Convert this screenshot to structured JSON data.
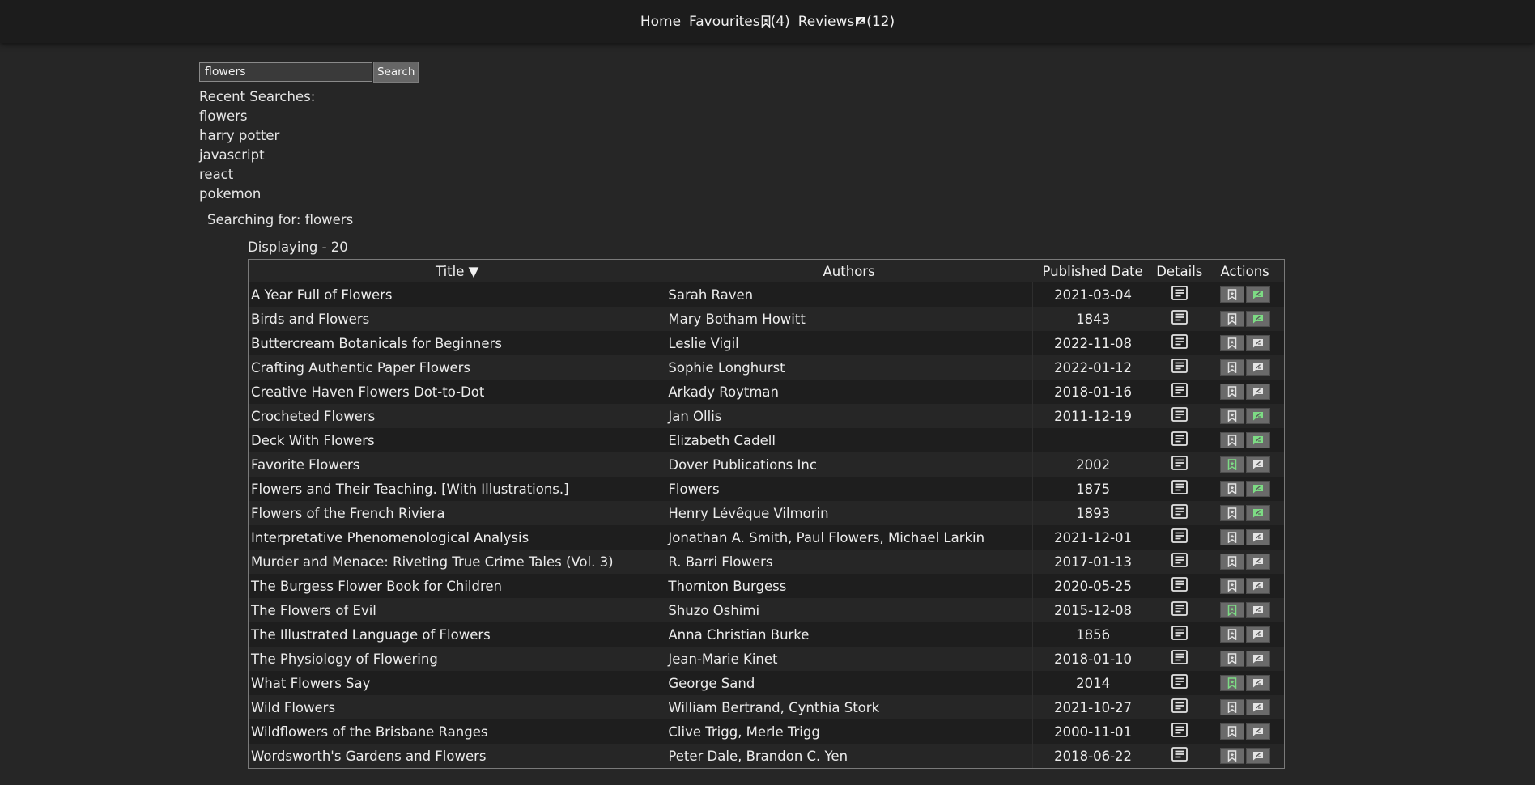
{
  "nav": {
    "home_label": "Home",
    "favourites_label": "Favourites",
    "favourites_count": "(4)",
    "reviews_label": "Reviews",
    "reviews_count": "(12)"
  },
  "search": {
    "value": "flowers",
    "button_label": "Search"
  },
  "recent": {
    "heading": "Recent Searches:",
    "items": [
      "flowers",
      "harry potter",
      "javascript",
      "react",
      "pokemon"
    ]
  },
  "status": {
    "searching_for": "Searching for: flowers",
    "displaying": "Displaying - 20"
  },
  "table": {
    "headers": {
      "title": "Title ▼",
      "authors": "Authors",
      "published": "Published Date",
      "details": "Details",
      "actions": "Actions"
    },
    "rows": [
      {
        "title": "A Year Full of Flowers",
        "authors": "Sarah Raven",
        "date": "2021-03-04",
        "favourite": false,
        "reviewed": true
      },
      {
        "title": "Birds and Flowers",
        "authors": "Mary Botham Howitt",
        "date": "1843",
        "favourite": false,
        "reviewed": true
      },
      {
        "title": "Buttercream Botanicals for Beginners",
        "authors": "Leslie Vigil",
        "date": "2022-11-08",
        "favourite": false,
        "reviewed": false
      },
      {
        "title": "Crafting Authentic Paper Flowers",
        "authors": "Sophie Longhurst",
        "date": "2022-01-12",
        "favourite": false,
        "reviewed": false
      },
      {
        "title": "Creative Haven Flowers Dot-to-Dot",
        "authors": "Arkady Roytman",
        "date": "2018-01-16",
        "favourite": false,
        "reviewed": false
      },
      {
        "title": "Crocheted Flowers",
        "authors": "Jan Ollis",
        "date": "2011-12-19",
        "favourite": false,
        "reviewed": true
      },
      {
        "title": "Deck With Flowers",
        "authors": "Elizabeth Cadell",
        "date": "",
        "favourite": false,
        "reviewed": true
      },
      {
        "title": "Favorite Flowers",
        "authors": "Dover Publications Inc",
        "date": "2002",
        "favourite": true,
        "reviewed": false
      },
      {
        "title": "Flowers and Their Teaching. [With Illustrations.]",
        "authors": "Flowers",
        "date": "1875",
        "favourite": false,
        "reviewed": true
      },
      {
        "title": "Flowers of the French Riviera",
        "authors": "Henry Lévêque Vilmorin",
        "date": "1893",
        "favourite": false,
        "reviewed": true
      },
      {
        "title": "Interpretative Phenomenological Analysis",
        "authors": "Jonathan A. Smith, Paul Flowers, Michael Larkin",
        "date": "2021-12-01",
        "favourite": false,
        "reviewed": false
      },
      {
        "title": "Murder and Menace: Riveting True Crime Tales (Vol. 3)",
        "authors": "R. Barri Flowers",
        "date": "2017-01-13",
        "favourite": false,
        "reviewed": false
      },
      {
        "title": "The Burgess Flower Book for Children",
        "authors": "Thornton Burgess",
        "date": "2020-05-25",
        "favourite": false,
        "reviewed": false
      },
      {
        "title": "The Flowers of Evil",
        "authors": "Shuzo Oshimi",
        "date": "2015-12-08",
        "favourite": true,
        "reviewed": false
      },
      {
        "title": "The Illustrated Language of Flowers",
        "authors": "Anna Christian Burke",
        "date": "1856",
        "favourite": false,
        "reviewed": false
      },
      {
        "title": "The Physiology of Flowering",
        "authors": "Jean-Marie Kinet",
        "date": "2018-01-10",
        "favourite": false,
        "reviewed": false
      },
      {
        "title": "What Flowers Say",
        "authors": "George Sand",
        "date": "2014",
        "favourite": true,
        "reviewed": false
      },
      {
        "title": "Wild Flowers",
        "authors": "William Bertrand, Cynthia Stork",
        "date": "2021-10-27",
        "favourite": false,
        "reviewed": false
      },
      {
        "title": "Wildflowers of the Brisbane Ranges",
        "authors": "Clive Trigg, Merle Trigg",
        "date": "2000-11-01",
        "favourite": false,
        "reviewed": false
      },
      {
        "title": "Wordsworth's Gardens and Flowers",
        "authors": "Peter Dale, Brandon C. Yen",
        "date": "2018-06-22",
        "favourite": false,
        "reviewed": false
      }
    ]
  },
  "colors": {
    "icon_off": "#e4e4e4",
    "icon_on": "#7ddb84"
  },
  "icons": {
    "details": "details-icon",
    "favourite": "bookmark-icon",
    "review": "review-icon"
  }
}
